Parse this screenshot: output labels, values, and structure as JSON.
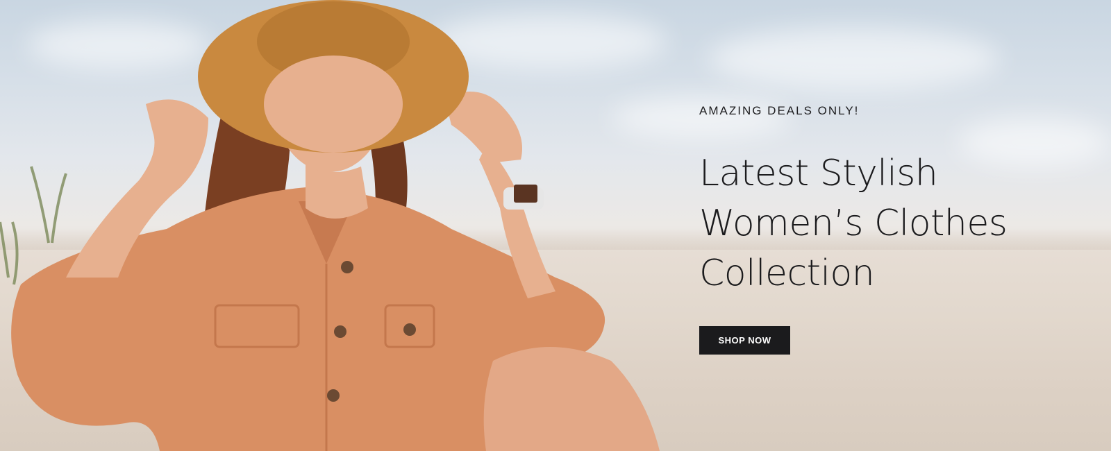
{
  "hero": {
    "eyebrow": "AMAZING DEALS ONLY!",
    "headline_lines": [
      "Latest Stylish",
      "Women’s Clothes",
      "Collection"
    ],
    "cta_label": "SHOP NOW"
  },
  "colors": {
    "text": "#1b1b1d",
    "button_bg": "#1b1b1d",
    "button_text": "#ffffff",
    "shirt": "#d98f63",
    "hat": "#c9893f",
    "hair": "#7a3f22",
    "skin": "#e7b08f"
  }
}
